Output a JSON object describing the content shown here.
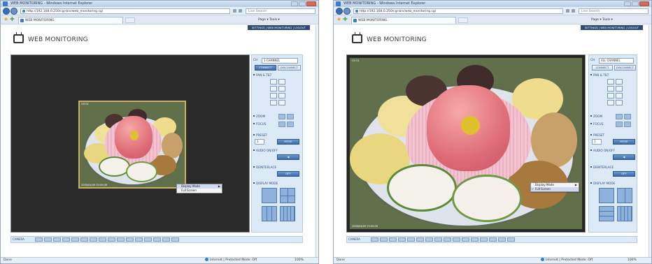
{
  "colors": {
    "nav": "#2c4b75",
    "panel": "#dce9f6",
    "panel_text": "#2d4e80",
    "viewer_bg": "#2a2a2a"
  },
  "windows": [
    {
      "title": "WEB MONITORING - Windows Internet Explorer",
      "url": "http://192.168.0.250/cgi-bin/web_monitoring.cgi",
      "search_placeholder": "Live Search",
      "tab_title": "WEB MONITORING",
      "tools": "Page ▾  Tools ▾",
      "top_nav": "SETTINGS  |  WEB MONITORING  |  LOGOUT",
      "brand": "WEB MONITORING",
      "channel_label": "CH",
      "channel_value": "1 CHANNEL",
      "connect": "CONNECT",
      "disconnect": "DISCONNECT",
      "pan_tilt": "PAN & TILT",
      "zoom": "ZOOM",
      "focus": "FOCUS",
      "preset": "PRESET",
      "preset_value": "1",
      "move": "MOVE",
      "audio": "AUDIO ON/OFF",
      "deinterlace": "DEINTERLACE",
      "deinterlace_value": "OFF",
      "display_mode": "DISPLAY MODE",
      "camera_label": "CAMERA",
      "stamp_tl": "CH 01",
      "stamp_bl": "2009/04/09 15:09:06",
      "menu": [
        {
          "label": "Display Mode",
          "arrow": "▶"
        },
        {
          "label": "Full Screen",
          "arrow": ""
        }
      ],
      "status_left": "Done",
      "status_zone": "Internet | Protected Mode: Off",
      "status_zoom": "100%"
    },
    {
      "title": "WEB MONITORING - Windows Internet Explorer",
      "url": "http://192.168.0.250/cgi-bin/web_monitoring.cgi",
      "search_placeholder": "Live Search",
      "tab_title": "WEB MONITORING",
      "tools": "Page ▾  Tools ▾",
      "top_nav": "SETTINGS  |  WEB MONITORING  |  LOGOUT",
      "brand": "WEB MONITORING",
      "channel_label": "CH",
      "channel_value": "ALL CHANNEL",
      "connect": "CONNECT",
      "disconnect": "DISCONNECT",
      "pan_tilt": "PAN & TILT",
      "zoom": "ZOOM",
      "focus": "FOCUS",
      "preset": "PRESET",
      "preset_value": "1",
      "move": "MOVE",
      "audio": "AUDIO ON/OFF",
      "deinterlace": "DEINTERLACE",
      "deinterlace_value": "OFF",
      "display_mode": "DISPLAY MODE",
      "camera_label": "CAMERA",
      "stamp_tl": "CH 01",
      "stamp_bl": "2009/04/09 15:09:06",
      "menu": [
        {
          "label": "Display Mode",
          "arrow": "▶"
        },
        {
          "label": "Full Screen",
          "arrow": ""
        }
      ],
      "status_left": "Done",
      "status_zone": "Internet | Protected Mode: Off",
      "status_zoom": "100%"
    }
  ]
}
